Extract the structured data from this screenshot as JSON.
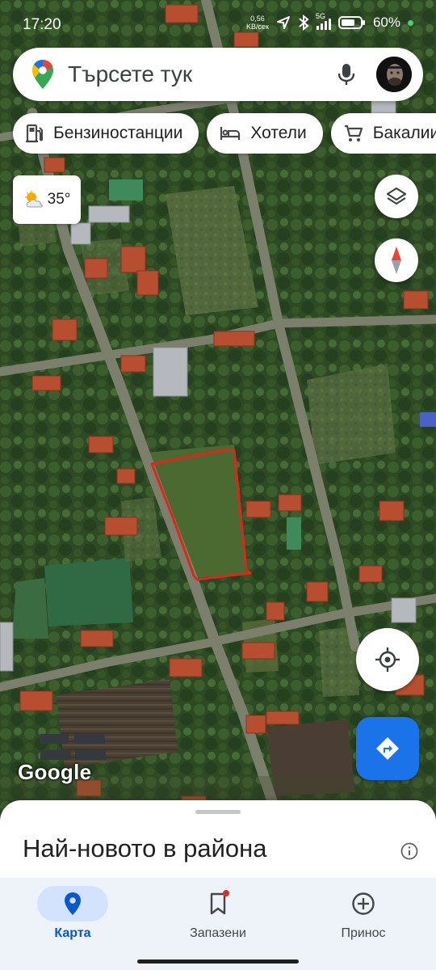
{
  "status_bar": {
    "time": "17:20",
    "net_speed_value": "0,56",
    "net_speed_unit": "KB/сек",
    "network": "5G",
    "battery": "60%"
  },
  "search": {
    "placeholder": "Търсете тук"
  },
  "chips": [
    {
      "label": "Бензиностанции",
      "icon": "gas-station-icon"
    },
    {
      "label": "Хотели",
      "icon": "hotel-bed-icon"
    },
    {
      "label": "Бакалии",
      "icon": "cart-icon"
    }
  ],
  "weather": {
    "temperature": "35°",
    "icon": "partly-cloudy-icon"
  },
  "map": {
    "attribution": "Google",
    "marked_area_color": "#e0261c"
  },
  "sheet": {
    "title": "Най-новото в района"
  },
  "nav": {
    "items": [
      {
        "label": "Карта",
        "icon": "map-pin-icon",
        "active": true
      },
      {
        "label": "Запазени",
        "icon": "bookmark-icon",
        "active": false
      },
      {
        "label": "Принос",
        "icon": "add-circle-icon",
        "active": false
      }
    ]
  },
  "colors": {
    "accent": "#1a73e8",
    "nav_active": "#0b57d0",
    "nav_active_bg": "#d3e3fd",
    "nav_bg": "#eef2f9"
  }
}
